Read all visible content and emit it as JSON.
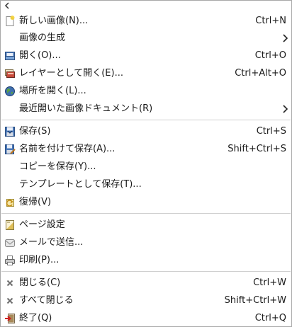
{
  "menu": {
    "items": [
      {
        "label": "新しい画像(N)...",
        "accel": "Ctrl+N",
        "icon": "new-image-icon"
      },
      {
        "label": "画像の生成",
        "accel": "",
        "icon": "",
        "submenu": true
      },
      {
        "label": "開く(O)...",
        "accel": "Ctrl+O",
        "icon": "open-icon"
      },
      {
        "label": "レイヤーとして開く(E)...",
        "accel": "Ctrl+Alt+O",
        "icon": "open-as-layers-icon"
      },
      {
        "label": "場所を開く(L)...",
        "accel": "",
        "icon": "globe-icon"
      },
      {
        "label": "最近開いた画像ドキュメント(R)",
        "accel": "",
        "icon": "",
        "submenu": true
      },
      {
        "label": "保存(S)",
        "accel": "Ctrl+S",
        "icon": "save-icon"
      },
      {
        "label": "名前を付けて保存(A)...",
        "accel": "Shift+Ctrl+S",
        "icon": "save-as-icon"
      },
      {
        "label": "コピーを保存(Y)...",
        "accel": "",
        "icon": ""
      },
      {
        "label": "テンプレートとして保存(T)...",
        "accel": "",
        "icon": ""
      },
      {
        "label": "復帰(V)",
        "accel": "",
        "icon": "revert-icon"
      },
      {
        "label": "ページ設定",
        "accel": "",
        "icon": "page-setup-icon"
      },
      {
        "label": "メールで送信...",
        "accel": "",
        "icon": "mail-icon"
      },
      {
        "label": "印刷(P)...",
        "accel": "",
        "icon": "print-icon"
      },
      {
        "label": "閉じる(C)",
        "accel": "Ctrl+W",
        "icon": "close-icon"
      },
      {
        "label": "すべて閉じる",
        "accel": "Shift+Ctrl+W",
        "icon": "close-all-icon"
      },
      {
        "label": "終了(Q)",
        "accel": "Ctrl+Q",
        "icon": "quit-icon"
      }
    ]
  }
}
